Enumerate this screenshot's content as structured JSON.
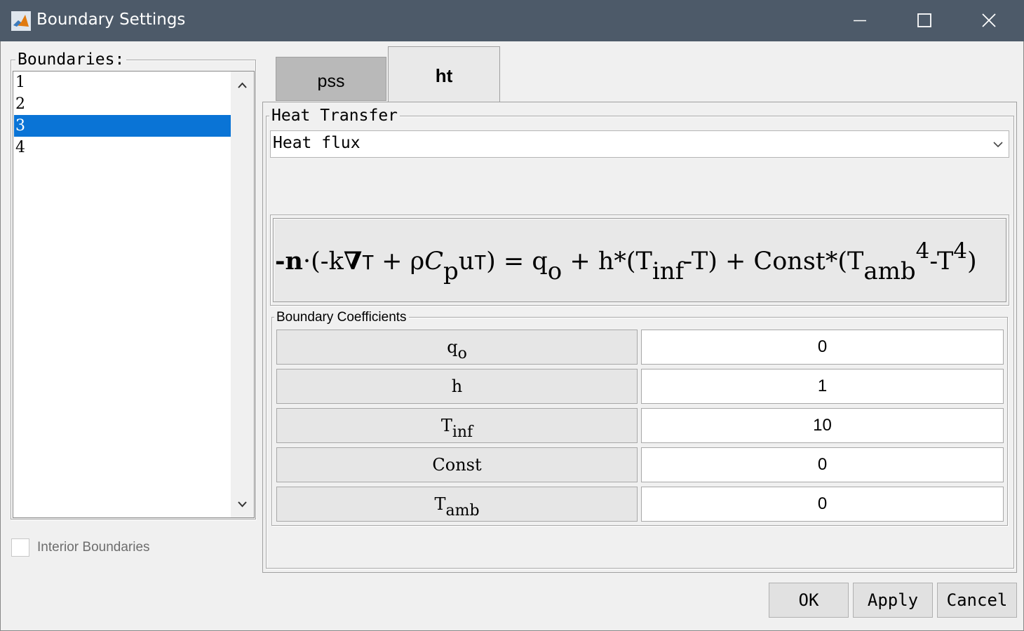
{
  "window": {
    "title": "Boundary Settings",
    "titlebar_color": "#4d5a69"
  },
  "boundaries": {
    "group_title": "Boundaries:",
    "items": [
      "1",
      "2",
      "3",
      "4"
    ],
    "selected": "3",
    "selection_color": "#0a74d6"
  },
  "interior": {
    "label": "Interior Boundaries",
    "checked": false
  },
  "tabs": [
    {
      "label": "pss",
      "active": false
    },
    {
      "label": "ht",
      "active": true
    }
  ],
  "heat_transfer": {
    "group_title": "Heat Transfer",
    "selected_option": "Heat flux"
  },
  "equation": {
    "lhs_minus": "-",
    "n": "n",
    "dot": "·",
    "open": "(-k",
    "nabla": "∇",
    "T1": "T",
    "plus1": " + ρ",
    "C": "C",
    "p": "p",
    "u": "u",
    "T2": "T",
    "close_eq": ") = q",
    "o": "o",
    "plus_h": " + h*(T",
    "inf": "inf",
    "minus_T": "-T) + Const*(T",
    "amb": "amb",
    "four1": "4",
    "minus_T2": "-T",
    "four2": "4",
    "end": ")"
  },
  "coefficients": {
    "group_title": "Boundary Coefficients",
    "rows": [
      {
        "name": "q",
        "sub": "o",
        "value": "0"
      },
      {
        "name": "h",
        "sub": "",
        "value": "1"
      },
      {
        "name": "T",
        "sub": "inf",
        "value": "10"
      },
      {
        "name": "Const",
        "sub": "",
        "value": "0"
      },
      {
        "name": "T",
        "sub": "amb",
        "value": "0"
      }
    ]
  },
  "buttons": {
    "ok": "OK",
    "apply": "Apply",
    "cancel": "Cancel"
  }
}
